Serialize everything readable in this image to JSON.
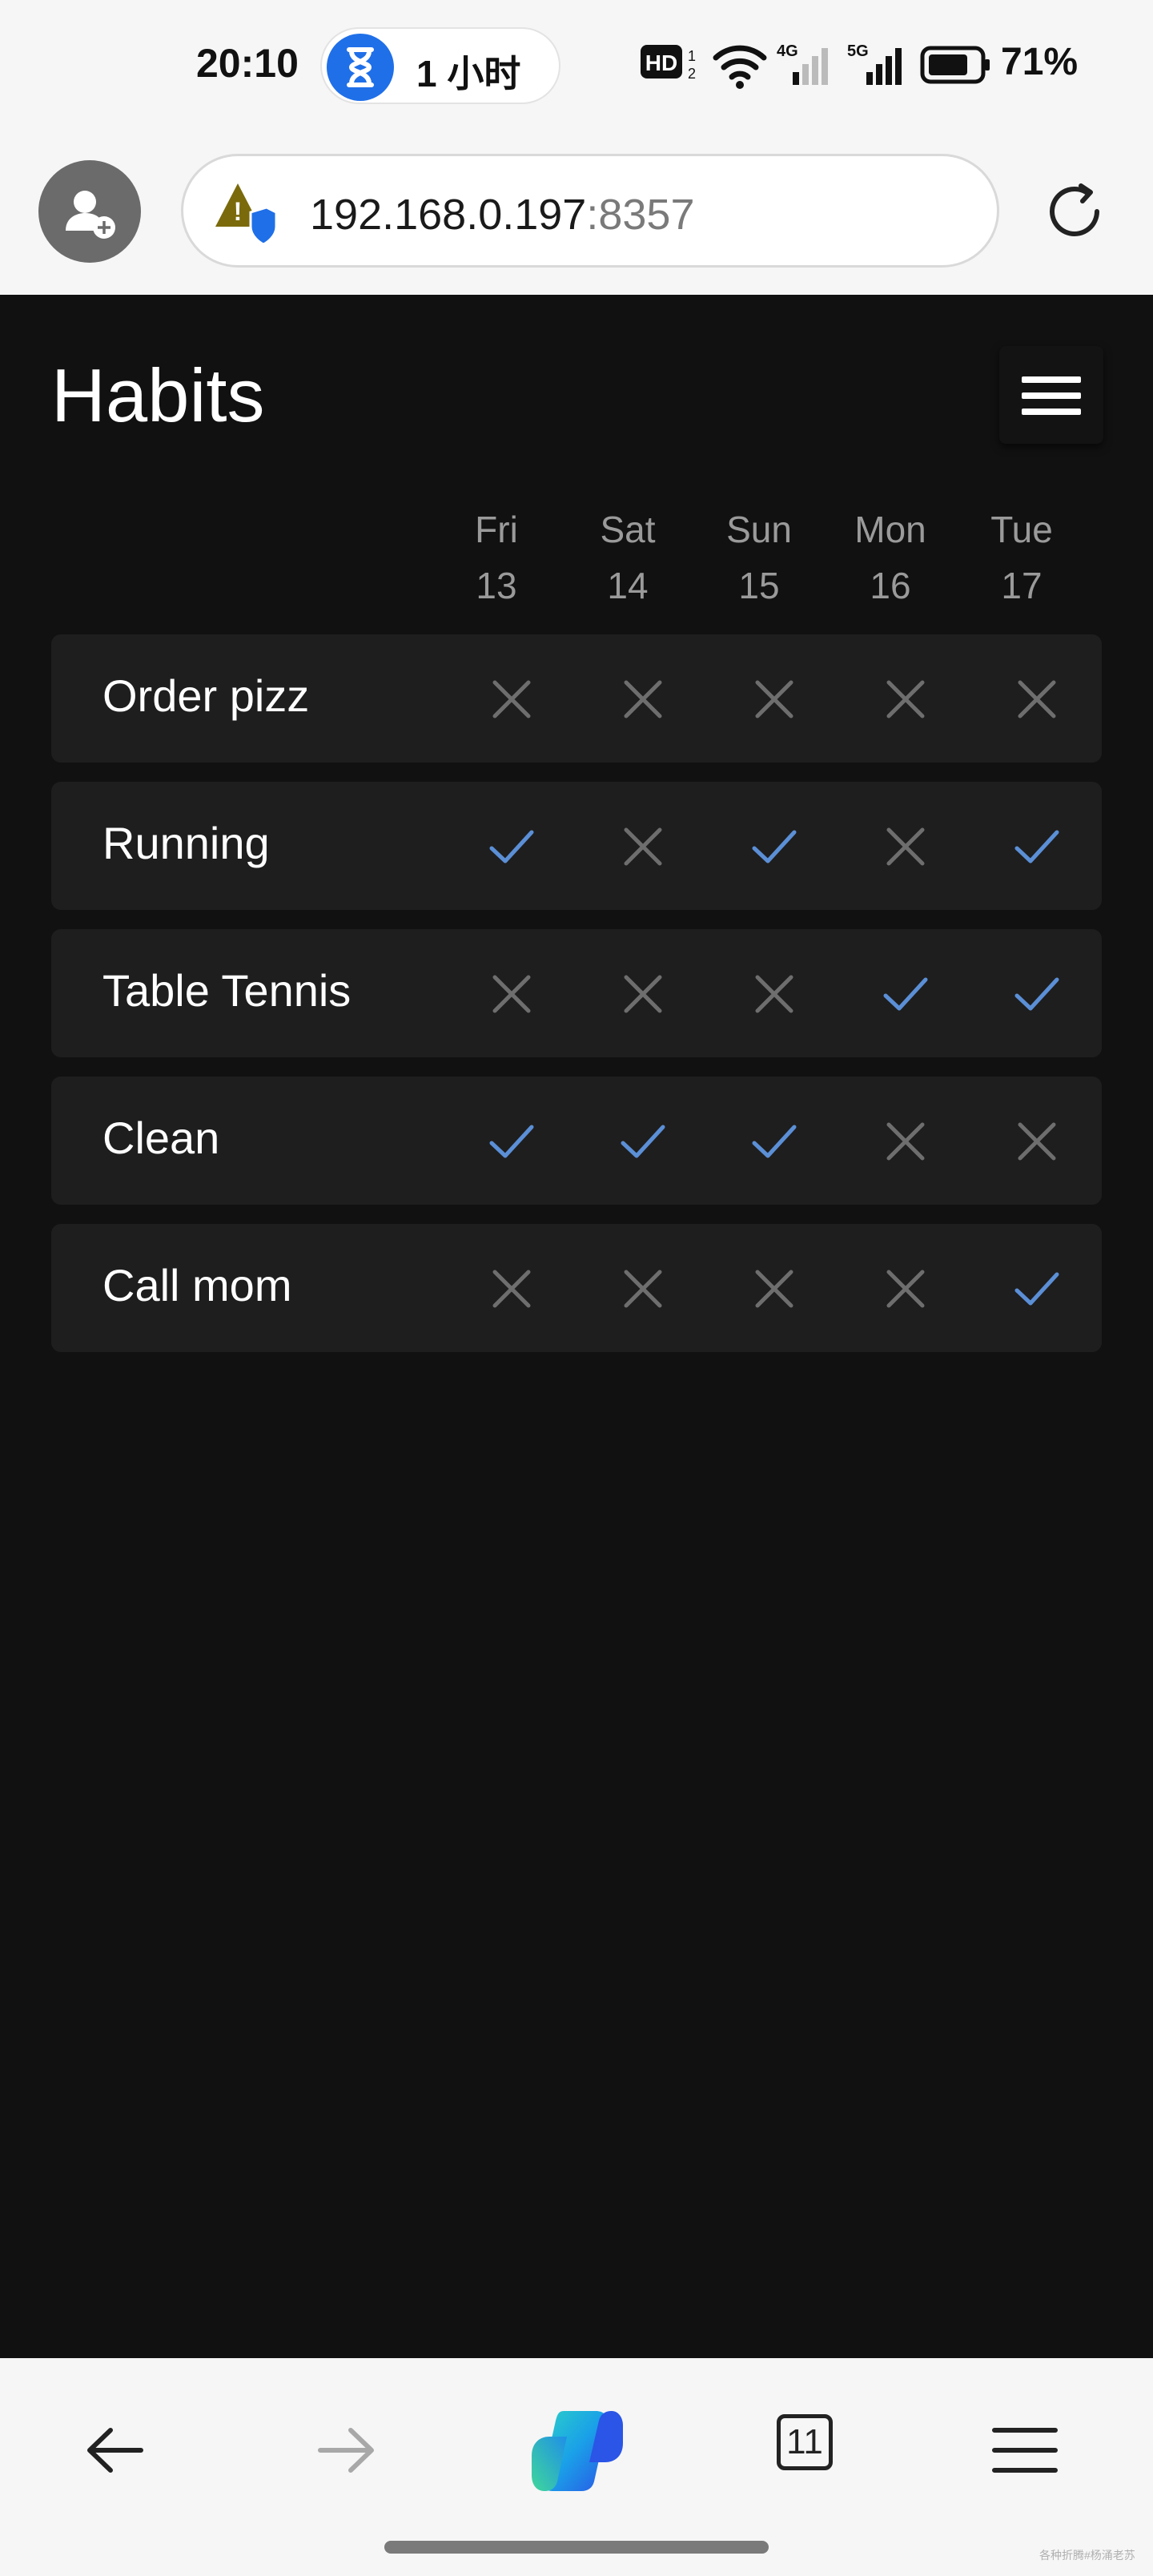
{
  "status_bar": {
    "time": "20:10",
    "timer_label": "1 小时",
    "network_hd": "HD",
    "network_4g": "4G",
    "network_5g": "5G",
    "battery_percent": "71%"
  },
  "browser": {
    "url_host": "192.168.0.197",
    "url_port": ":8357",
    "tab_count": "11"
  },
  "page": {
    "title": "Habits",
    "days": [
      {
        "name": "Fri",
        "date": "13"
      },
      {
        "name": "Sat",
        "date": "14"
      },
      {
        "name": "Sun",
        "date": "15"
      },
      {
        "name": "Mon",
        "date": "16"
      },
      {
        "name": "Tue",
        "date": "17"
      }
    ],
    "habits": [
      {
        "name": "Order pizz",
        "checks": [
          false,
          false,
          false,
          false,
          false
        ]
      },
      {
        "name": "Running",
        "checks": [
          true,
          false,
          true,
          false,
          true
        ]
      },
      {
        "name": "Table Tennis",
        "checks": [
          false,
          false,
          false,
          true,
          true
        ]
      },
      {
        "name": "Clean",
        "checks": [
          true,
          true,
          true,
          false,
          false
        ]
      },
      {
        "name": "Call mom",
        "checks": [
          false,
          false,
          false,
          false,
          true
        ]
      }
    ]
  },
  "colors": {
    "check": "#5b8fd6",
    "cross": "#6e6e6e",
    "row_bg": "#1e1e1e",
    "page_bg": "#111111"
  },
  "watermark": "各种折腾#杨涌老苏"
}
